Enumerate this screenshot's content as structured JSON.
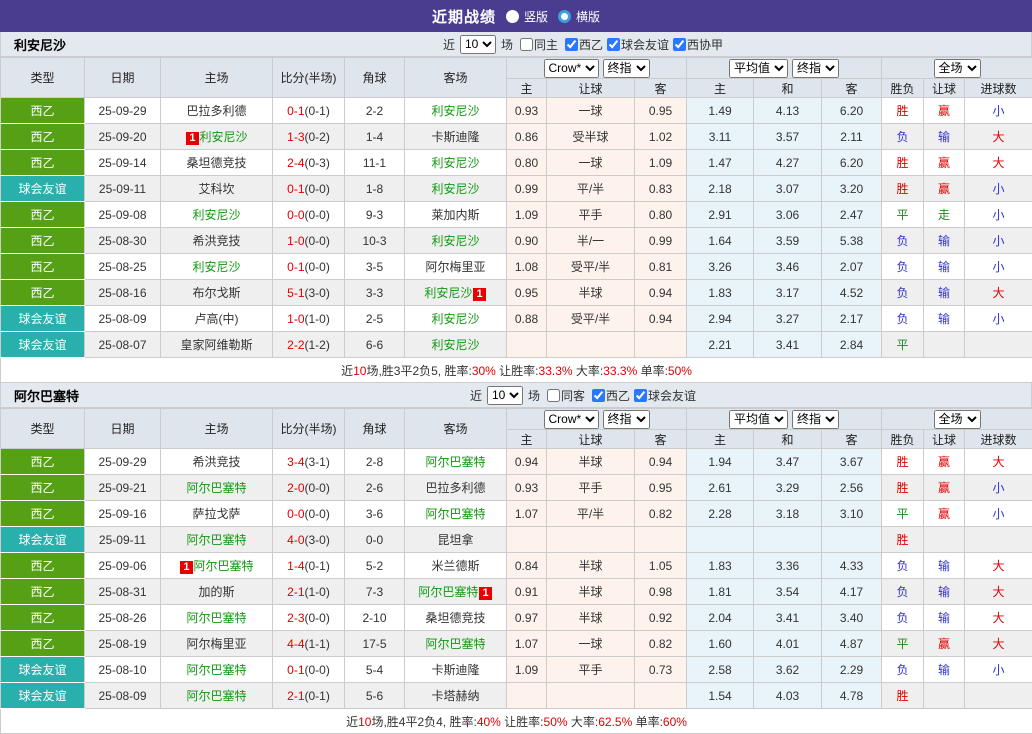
{
  "topbar": {
    "title": "近期战绩",
    "vertical_label": "竖版",
    "horizontal_label": "横版"
  },
  "colors": {
    "topbar_bg": "#4a3c8f",
    "league_badge": "#55a014",
    "friendly_badge": "#29b0ac",
    "team_green": "#119911",
    "win_red": "#e00000",
    "lose_blue": "#3333cc",
    "draw_green": "#1a8a1a",
    "crow_col_bg": "#fdf3ec",
    "avg_col_bg": "#e9f4fa"
  },
  "table_meta": {
    "left_headers": [
      "类型",
      "日期",
      "主场",
      "比分(半场)",
      "角球",
      "客场"
    ],
    "sub_headers": [
      "主",
      "让球",
      "客",
      "主",
      "和",
      "客",
      "胜负",
      "让球",
      "进球数"
    ],
    "crow_selects": [
      "Crow*",
      "终指"
    ],
    "avg_selects": [
      "平均值",
      "终指"
    ],
    "scope_select": "全场",
    "type_colors": {
      "西乙": "#55a014",
      "球会友谊": "#29b0ac"
    }
  },
  "sections": [
    {
      "team": "利安尼沙",
      "filters": {
        "prefix": "近",
        "count": "10",
        "suffix": "场",
        "same_label": "同主",
        "same_checked": false,
        "leagues": [
          {
            "label": "西乙",
            "checked": true
          },
          {
            "label": "球会友谊",
            "checked": true
          },
          {
            "label": "西协甲",
            "checked": true
          }
        ]
      },
      "rows": [
        {
          "type": "西乙",
          "date": "25-09-29",
          "home": {
            "name": "巴拉多利德"
          },
          "score": {
            "ft": "0-1",
            "ht": "(0-1)"
          },
          "corner": "2-2",
          "away": {
            "name": "利安尼沙",
            "green": true
          },
          "crow": [
            "0.93",
            "一球",
            "0.95"
          ],
          "avg": [
            "1.49",
            "4.13",
            "6.20"
          ],
          "res": [
            "胜",
            "赢",
            "小"
          ]
        },
        {
          "type": "西乙",
          "date": "25-09-20",
          "home": {
            "name": "利安尼沙",
            "green": true,
            "rc": "before"
          },
          "score": {
            "ft": "1-3",
            "ht": "(0-2)"
          },
          "corner": "1-4",
          "away": {
            "name": "卡斯迪隆"
          },
          "crow": [
            "0.86",
            "受半球",
            "1.02"
          ],
          "avg": [
            "3.11",
            "3.57",
            "2.11"
          ],
          "res": [
            "负",
            "输",
            "大"
          ]
        },
        {
          "type": "西乙",
          "date": "25-09-14",
          "home": {
            "name": "桑坦德竞技"
          },
          "score": {
            "ft": "2-4",
            "ht": "(0-3)"
          },
          "corner": "11-1",
          "away": {
            "name": "利安尼沙",
            "green": true
          },
          "crow": [
            "0.80",
            "一球",
            "1.09"
          ],
          "avg": [
            "1.47",
            "4.27",
            "6.20"
          ],
          "res": [
            "胜",
            "赢",
            "大"
          ]
        },
        {
          "type": "球会友谊",
          "date": "25-09-11",
          "home": {
            "name": "艾科坎"
          },
          "score": {
            "ft": "0-1",
            "ht": "(0-0)"
          },
          "corner": "1-8",
          "away": {
            "name": "利安尼沙",
            "green": true
          },
          "crow": [
            "0.99",
            "平/半",
            "0.83"
          ],
          "avg": [
            "2.18",
            "3.07",
            "3.20"
          ],
          "res": [
            "胜",
            "赢",
            "小"
          ]
        },
        {
          "type": "西乙",
          "date": "25-09-08",
          "home": {
            "name": "利安尼沙",
            "green": true
          },
          "score": {
            "ft": "0-0",
            "ht": "(0-0)"
          },
          "corner": "9-3",
          "away": {
            "name": "莱加内斯"
          },
          "crow": [
            "1.09",
            "平手",
            "0.80"
          ],
          "avg": [
            "2.91",
            "3.06",
            "2.47"
          ],
          "res": [
            "平",
            "走",
            "小"
          ]
        },
        {
          "type": "西乙",
          "date": "25-08-30",
          "home": {
            "name": "希洪竞技"
          },
          "score": {
            "ft": "1-0",
            "ht": "(0-0)"
          },
          "corner": "10-3",
          "away": {
            "name": "利安尼沙",
            "green": true
          },
          "crow": [
            "0.90",
            "半/一",
            "0.99"
          ],
          "avg": [
            "1.64",
            "3.59",
            "5.38"
          ],
          "res": [
            "负",
            "输",
            "小"
          ]
        },
        {
          "type": "西乙",
          "date": "25-08-25",
          "home": {
            "name": "利安尼沙",
            "green": true
          },
          "score": {
            "ft": "0-1",
            "ht": "(0-0)"
          },
          "corner": "3-5",
          "away": {
            "name": "阿尔梅里亚"
          },
          "crow": [
            "1.08",
            "受平/半",
            "0.81"
          ],
          "avg": [
            "3.26",
            "3.46",
            "2.07"
          ],
          "res": [
            "负",
            "输",
            "小"
          ]
        },
        {
          "type": "西乙",
          "date": "25-08-16",
          "home": {
            "name": "布尔戈斯"
          },
          "score": {
            "ft": "5-1",
            "ht": "(3-0)"
          },
          "corner": "3-3",
          "away": {
            "name": "利安尼沙",
            "green": true,
            "rc": "after"
          },
          "crow": [
            "0.95",
            "半球",
            "0.94"
          ],
          "avg": [
            "1.83",
            "3.17",
            "4.52"
          ],
          "res": [
            "负",
            "输",
            "大"
          ]
        },
        {
          "type": "球会友谊",
          "date": "25-08-09",
          "home": {
            "name": "卢高(中)"
          },
          "score": {
            "ft": "1-0",
            "ht": "(1-0)"
          },
          "corner": "2-5",
          "away": {
            "name": "利安尼沙",
            "green": true
          },
          "crow": [
            "0.88",
            "受平/半",
            "0.94"
          ],
          "avg": [
            "2.94",
            "3.27",
            "2.17"
          ],
          "res": [
            "负",
            "输",
            "小"
          ]
        },
        {
          "type": "球会友谊",
          "date": "25-08-07",
          "home": {
            "name": "皇家阿维勒斯"
          },
          "score": {
            "ft": "2-2",
            "ht": "(1-2)"
          },
          "corner": "6-6",
          "away": {
            "name": "利安尼沙",
            "green": true
          },
          "crow": [
            "",
            "",
            ""
          ],
          "avg": [
            "2.21",
            "3.41",
            "2.84"
          ],
          "res": [
            "平",
            "",
            ""
          ]
        }
      ],
      "summary": [
        [
          "近",
          false
        ],
        [
          "10",
          true
        ],
        [
          "场,胜3平2负5, 胜率:",
          false
        ],
        [
          "30%",
          true
        ],
        [
          " 让胜率:",
          false
        ],
        [
          "33.3%",
          true
        ],
        [
          " 大率:",
          false
        ],
        [
          "33.3%",
          true
        ],
        [
          " 单率:",
          false
        ],
        [
          "50%",
          true
        ]
      ]
    },
    {
      "team": "阿尔巴塞特",
      "filters": {
        "prefix": "近",
        "count": "10",
        "suffix": "场",
        "same_label": "同客",
        "same_checked": false,
        "leagues": [
          {
            "label": "西乙",
            "checked": true
          },
          {
            "label": "球会友谊",
            "checked": true
          }
        ]
      },
      "rows": [
        {
          "type": "西乙",
          "date": "25-09-29",
          "home": {
            "name": "希洪竞技"
          },
          "score": {
            "ft": "3-4",
            "ht": "(3-1)"
          },
          "corner": "2-8",
          "away": {
            "name": "阿尔巴塞特",
            "green": true
          },
          "crow": [
            "0.94",
            "半球",
            "0.94"
          ],
          "avg": [
            "1.94",
            "3.47",
            "3.67"
          ],
          "res": [
            "胜",
            "赢",
            "大"
          ]
        },
        {
          "type": "西乙",
          "date": "25-09-21",
          "home": {
            "name": "阿尔巴塞特",
            "green": true
          },
          "score": {
            "ft": "2-0",
            "ht": "(0-0)"
          },
          "corner": "2-6",
          "away": {
            "name": "巴拉多利德"
          },
          "crow": [
            "0.93",
            "平手",
            "0.95"
          ],
          "avg": [
            "2.61",
            "3.29",
            "2.56"
          ],
          "res": [
            "胜",
            "赢",
            "小"
          ]
        },
        {
          "type": "西乙",
          "date": "25-09-16",
          "home": {
            "name": "萨拉戈萨"
          },
          "score": {
            "ft": "0-0",
            "ht": "(0-0)"
          },
          "corner": "3-6",
          "away": {
            "name": "阿尔巴塞特",
            "green": true
          },
          "crow": [
            "1.07",
            "平/半",
            "0.82"
          ],
          "avg": [
            "2.28",
            "3.18",
            "3.10"
          ],
          "res": [
            "平",
            "赢",
            "小"
          ]
        },
        {
          "type": "球会友谊",
          "date": "25-09-11",
          "home": {
            "name": "阿尔巴塞特",
            "green": true
          },
          "score": {
            "ft": "4-0",
            "ht": "(3-0)"
          },
          "corner": "0-0",
          "away": {
            "name": "昆坦拿"
          },
          "crow": [
            "",
            "",
            ""
          ],
          "avg": [
            "",
            "",
            ""
          ],
          "res": [
            "胜",
            "",
            ""
          ]
        },
        {
          "type": "西乙",
          "date": "25-09-06",
          "home": {
            "name": "阿尔巴塞特",
            "green": true,
            "rc": "before"
          },
          "score": {
            "ft": "1-4",
            "ht": "(0-1)"
          },
          "corner": "5-2",
          "away": {
            "name": "米兰德斯"
          },
          "crow": [
            "0.84",
            "半球",
            "1.05"
          ],
          "avg": [
            "1.83",
            "3.36",
            "4.33"
          ],
          "res": [
            "负",
            "输",
            "大"
          ]
        },
        {
          "type": "西乙",
          "date": "25-08-31",
          "home": {
            "name": "加的斯"
          },
          "score": {
            "ft": "2-1",
            "ht": "(1-0)"
          },
          "corner": "7-3",
          "away": {
            "name": "阿尔巴塞特",
            "green": true,
            "rc": "after"
          },
          "crow": [
            "0.91",
            "半球",
            "0.98"
          ],
          "avg": [
            "1.81",
            "3.54",
            "4.17"
          ],
          "res": [
            "负",
            "输",
            "大"
          ]
        },
        {
          "type": "西乙",
          "date": "25-08-26",
          "home": {
            "name": "阿尔巴塞特",
            "green": true
          },
          "score": {
            "ft": "2-3",
            "ht": "(0-0)"
          },
          "corner": "2-10",
          "away": {
            "name": "桑坦德竞技"
          },
          "crow": [
            "0.97",
            "半球",
            "0.92"
          ],
          "avg": [
            "2.04",
            "3.41",
            "3.40"
          ],
          "res": [
            "负",
            "输",
            "大"
          ]
        },
        {
          "type": "西乙",
          "date": "25-08-19",
          "home": {
            "name": "阿尔梅里亚"
          },
          "score": {
            "ft": "4-4",
            "ht": "(1-1)"
          },
          "corner": "17-5",
          "away": {
            "name": "阿尔巴塞特",
            "green": true
          },
          "crow": [
            "1.07",
            "一球",
            "0.82"
          ],
          "avg": [
            "1.60",
            "4.01",
            "4.87"
          ],
          "res": [
            "平",
            "赢",
            "大"
          ]
        },
        {
          "type": "球会友谊",
          "date": "25-08-10",
          "home": {
            "name": "阿尔巴塞特",
            "green": true
          },
          "score": {
            "ft": "0-1",
            "ht": "(0-0)"
          },
          "corner": "5-4",
          "away": {
            "name": "卡斯迪隆"
          },
          "crow": [
            "1.09",
            "平手",
            "0.73"
          ],
          "avg": [
            "2.58",
            "3.62",
            "2.29"
          ],
          "res": [
            "负",
            "输",
            "小"
          ]
        },
        {
          "type": "球会友谊",
          "date": "25-08-09",
          "home": {
            "name": "阿尔巴塞特",
            "green": true
          },
          "score": {
            "ft": "2-1",
            "ht": "(0-1)"
          },
          "corner": "5-6",
          "away": {
            "name": "卡塔赫纳"
          },
          "crow": [
            "",
            "",
            ""
          ],
          "avg": [
            "1.54",
            "4.03",
            "4.78"
          ],
          "res": [
            "胜",
            "",
            ""
          ]
        }
      ],
      "summary": [
        [
          "近",
          false
        ],
        [
          "10",
          true
        ],
        [
          "场,胜4平2负4, 胜率:",
          false
        ],
        [
          "40%",
          true
        ],
        [
          " 让胜率:",
          false
        ],
        [
          "50%",
          true
        ],
        [
          " 大率:",
          false
        ],
        [
          "62.5%",
          true
        ],
        [
          " 单率:",
          false
        ],
        [
          "60%",
          true
        ]
      ]
    }
  ]
}
